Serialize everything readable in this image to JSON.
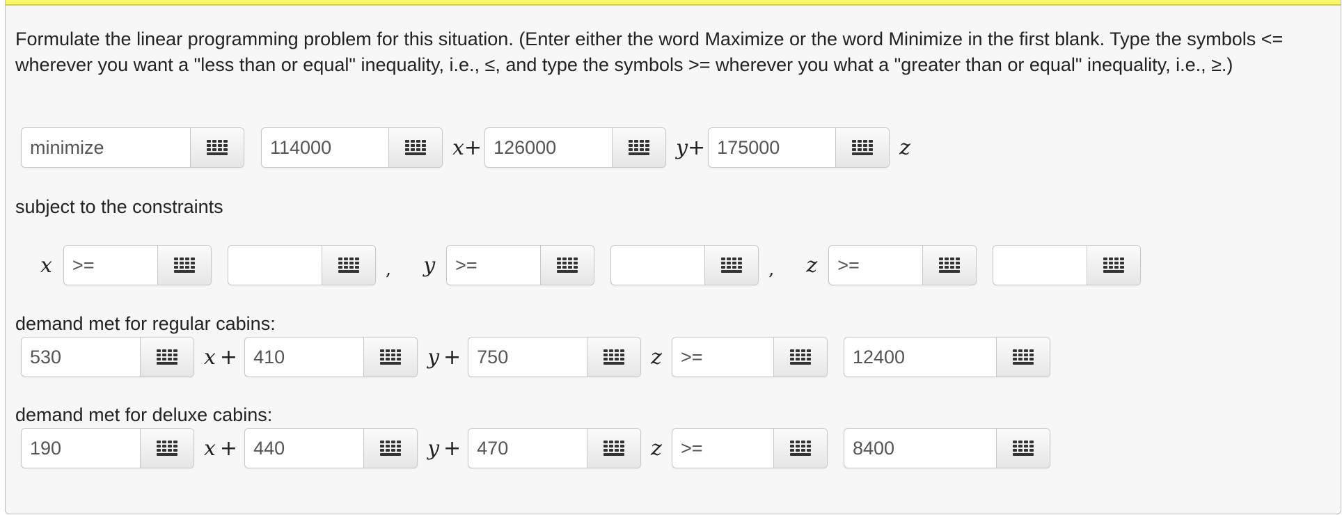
{
  "prompt": "Formulate the linear programming problem for this situation. (Enter either the word Maximize or the word Minimize in the first blank. Type the symbols <= wherever you want a \"less than or equal\" inequality, i.e., ≤, and type the symbols >= wherever you what a \"greater than or equal\" inequality, i.e., ≥.)",
  "objective": {
    "sense": "minimize",
    "coef_x": "114000",
    "coef_y": "126000",
    "coef_z": "175000"
  },
  "vars": {
    "x": "x",
    "y": "y",
    "z": "z"
  },
  "symbols": {
    "plus": "+",
    "comma": ","
  },
  "subject_label": "subject to the constraints",
  "nonneg": {
    "x_op": ">=",
    "x_val": "",
    "y_op": ">=",
    "y_val": "",
    "z_op": ">=",
    "z_val": ""
  },
  "regular": {
    "label": "demand met for regular cabins:",
    "coef_x": "530",
    "coef_y": "410",
    "coef_z": "750",
    "op": ">=",
    "rhs": "12400"
  },
  "deluxe": {
    "label": "demand met for deluxe cabins:",
    "coef_x": "190",
    "coef_y": "440",
    "coef_z": "470",
    "op": ">=",
    "rhs": "8400"
  },
  "icons": {
    "keypad": "keypad-grid-icon"
  },
  "colors": {
    "highlight_bar": "#faf86a",
    "panel_bg": "#f7f7f7"
  }
}
